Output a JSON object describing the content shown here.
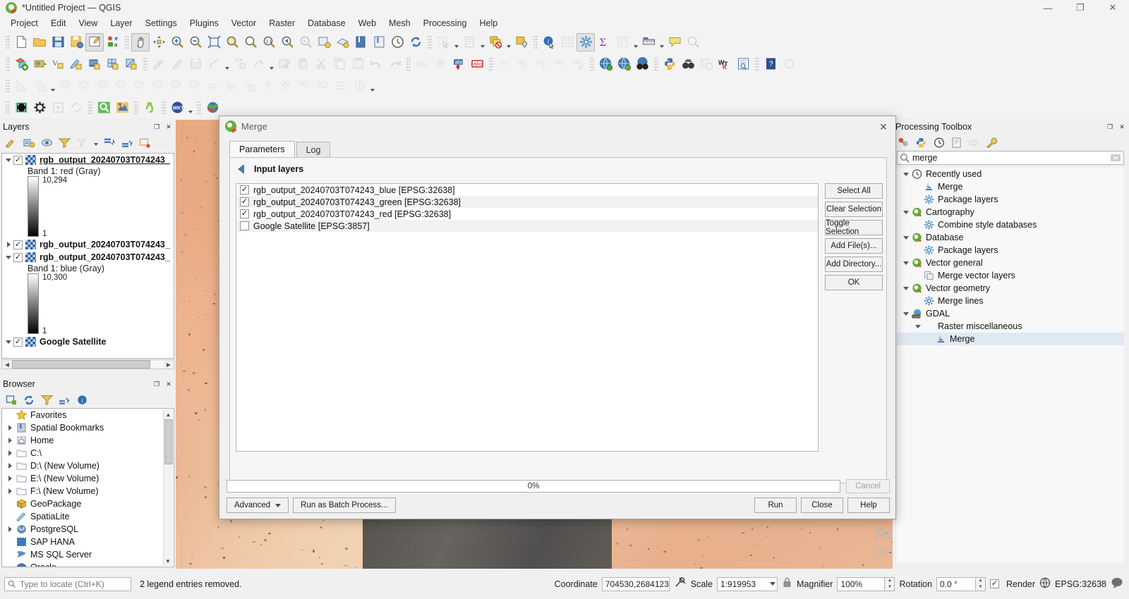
{
  "window": {
    "title": "*Untitled Project — QGIS",
    "app_icon": "qgis-logo-icon",
    "minimize": "—",
    "maximize": "❐",
    "close": "✕"
  },
  "menubar": {
    "items": [
      "Project",
      "Edit",
      "View",
      "Layer",
      "Settings",
      "Plugins",
      "Vector",
      "Raster",
      "Database",
      "Web",
      "Mesh",
      "Processing",
      "Help"
    ]
  },
  "toolbars": {
    "row1": [
      "new-project-icon",
      "open-project-icon",
      "save-project-icon",
      "save-project-as-icon",
      "new-print-layout-icon",
      "style-manager-icon",
      "pan-map-icon",
      "pan-to-selection-icon",
      "zoom-in-icon",
      "zoom-out-icon",
      "zoom-full-icon",
      "zoom-to-selection-icon",
      "zoom-to-layer-icon",
      "zoom-native-icon",
      "zoom-last-icon",
      "zoom-next-icon",
      "refresh-icon",
      "new-map-view-icon",
      "new-3d-map-view-icon",
      "show-bookmarks-icon",
      "temporal-controller-icon",
      "refresh-map-icon",
      "select-features-icon",
      "select-value-icon",
      "deselect-features-icon",
      "select-location-icon",
      "identify-features-icon",
      "open-attribute-table-icon",
      "processing-toolbox-icon",
      "statistical-summary-icon",
      "show-form-icon",
      "measure-line-icon",
      "map-tips-icon",
      "search-qms-icon"
    ],
    "row2": [
      "add-vector-layer-icon",
      "add-raster-layer-icon",
      "add-mesh-layer-icon",
      "add-delimited-text-layer-icon",
      "add-postgis-layer-icon",
      "add-spatialite-layer-icon",
      "add-wms-layer-icon",
      "current-edits-icon",
      "toggle-editing-icon",
      "save-layer-edits-icon",
      "add-line-feature-icon",
      "add-point-feature-icon",
      "vertex-tool-icon",
      "modify-attributes-icon",
      "delete-selected-icon",
      "cut-features-icon",
      "copy-features-icon",
      "paste-features-icon",
      "undo-icon",
      "redo-icon",
      "label-abc-icon",
      "label-toggle-icon",
      "pin-labels-icon",
      "highlight-labels-icon",
      "move-label-icon",
      "rotate-label-icon",
      "show-hide-labels-icon",
      "change-label-icon",
      "change-label-properties-icon",
      "metasearch-icon",
      "qgis-cloud-icon",
      "georeferencer-icon",
      "python-console-icon",
      "osm-place-search-icon",
      "raster-calculator-icon",
      "wkt-icon",
      "layout-manager-icon",
      "help-icon",
      "plugin-icon"
    ],
    "row3": [
      "measure-icon",
      "add-point-icon",
      "select-icon",
      "snapping-icon",
      "rotate-icon",
      "simplify-icon",
      "add-ring-icon",
      "add-part-icon",
      "fill-ring-icon",
      "delete-ring-icon",
      "delete-part-icon",
      "reshape-features-icon",
      "offset-curve-icon",
      "split-features-icon",
      "split-parts-icon",
      "merge-features-icon",
      "merge-attributes-icon",
      "rotate-point-symbols-icon",
      "offset-point-symbol-icon"
    ],
    "row4": [
      "contrast-icon",
      "options-icon",
      "add-tab-icon",
      "reload-icon",
      "qms-search-icon",
      "qms-icon",
      "lizmap-icon",
      "wkt-dropdown-icon",
      "earth-icon"
    ]
  },
  "layers_panel": {
    "title": "Layers",
    "tools": [
      "open-layer-styling-icon",
      "add-group-icon",
      "manage-map-themes-icon",
      "filter-legend-icon",
      "filter-legend-expression-icon",
      "expand-all-icon",
      "collapse-all-icon",
      "remove-layer-icon"
    ],
    "items": [
      {
        "name": "rgb_output_20240703T074243_",
        "checked": true,
        "expanded": true,
        "selected": true,
        "band_label": "Band 1: red (Gray)",
        "ramp_max": "10,294",
        "ramp_min": "1"
      },
      {
        "name": "rgb_output_20240703T074243_",
        "checked": true,
        "expanded": false,
        "selected": false,
        "band_label": null,
        "ramp_max": null,
        "ramp_min": null
      },
      {
        "name": "rgb_output_20240703T074243_",
        "checked": true,
        "expanded": true,
        "selected": false,
        "band_label": "Band 1: blue (Gray)",
        "ramp_max": "10,300",
        "ramp_min": "1"
      },
      {
        "name": "Google Satellite",
        "checked": true,
        "expanded": true,
        "selected": false,
        "band_label": null,
        "ramp_max": null,
        "ramp_min": null
      }
    ]
  },
  "browser_panel": {
    "title": "Browser",
    "tools": [
      "add-layer-icon",
      "refresh-icon",
      "filter-browser-icon",
      "collapse-all-icon",
      "properties-icon"
    ],
    "items": [
      {
        "label": "Favorites",
        "icon": "star-icon",
        "expandable": false
      },
      {
        "label": "Spatial Bookmarks",
        "icon": "bookmark-icon",
        "expandable": true
      },
      {
        "label": "Home",
        "icon": "home-icon",
        "expandable": true
      },
      {
        "label": "C:\\",
        "icon": "folder-icon",
        "expandable": true
      },
      {
        "label": "D:\\ (New Volume)",
        "icon": "folder-icon",
        "expandable": true
      },
      {
        "label": "E:\\ (New Volume)",
        "icon": "folder-icon",
        "expandable": true
      },
      {
        "label": "F:\\ (New Volume)",
        "icon": "folder-icon",
        "expandable": true
      },
      {
        "label": "GeoPackage",
        "icon": "geopackage-icon",
        "expandable": false
      },
      {
        "label": "SpatiaLite",
        "icon": "spatialite-icon",
        "expandable": false
      },
      {
        "label": "PostgreSQL",
        "icon": "postgresql-icon",
        "expandable": true
      },
      {
        "label": "SAP HANA",
        "icon": "sap-hana-icon",
        "expandable": false
      },
      {
        "label": "MS SQL Server",
        "icon": "mssql-icon",
        "expandable": false
      },
      {
        "label": "Oracle",
        "icon": "oracle-icon",
        "expandable": false
      }
    ]
  },
  "processing_toolbox": {
    "title": "Processing Toolbox",
    "tools": [
      "models-icon",
      "scripts-icon",
      "history-icon",
      "results-viewer-icon",
      "edit-rendering-styles-icon",
      "options-icon"
    ],
    "search": {
      "value": "merge",
      "clear_icon": "clear-search-icon",
      "search_icon": "search-icon"
    },
    "tree": [
      {
        "label": "Recently used",
        "icon": "clock-icon",
        "depth": 0,
        "expanded": true,
        "selected": false
      },
      {
        "label": "Merge",
        "icon": "gdal-merge-icon",
        "depth": 1,
        "expanded": null,
        "selected": false
      },
      {
        "label": "Package layers",
        "icon": "gear-blue-icon",
        "depth": 1,
        "expanded": null,
        "selected": false
      },
      {
        "label": "Cartography",
        "icon": "qgis-icon",
        "depth": 0,
        "expanded": true,
        "selected": false
      },
      {
        "label": "Combine style databases",
        "icon": "gear-blue-icon",
        "depth": 1,
        "expanded": null,
        "selected": false
      },
      {
        "label": "Database",
        "icon": "qgis-icon",
        "depth": 0,
        "expanded": true,
        "selected": false
      },
      {
        "label": "Package layers",
        "icon": "gear-blue-icon",
        "depth": 1,
        "expanded": null,
        "selected": false
      },
      {
        "label": "Vector general",
        "icon": "qgis-icon",
        "depth": 0,
        "expanded": true,
        "selected": false
      },
      {
        "label": "Merge vector layers",
        "icon": "merge-vector-icon",
        "depth": 1,
        "expanded": null,
        "selected": false
      },
      {
        "label": "Vector geometry",
        "icon": "qgis-icon",
        "depth": 0,
        "expanded": true,
        "selected": false
      },
      {
        "label": "Merge lines",
        "icon": "gear-blue-icon",
        "depth": 1,
        "expanded": null,
        "selected": false
      },
      {
        "label": "GDAL",
        "icon": "gdal-icon",
        "depth": 0,
        "expanded": true,
        "selected": false
      },
      {
        "label": "Raster miscellaneous",
        "icon": "",
        "depth": 1,
        "expanded": true,
        "selected": false
      },
      {
        "label": "Merge",
        "icon": "gdal-merge-icon",
        "depth": 2,
        "expanded": null,
        "selected": true
      }
    ]
  },
  "merge_dialog": {
    "title": "Merge",
    "close_icon": "close-icon",
    "tabs": [
      {
        "label": "Parameters",
        "active": true
      },
      {
        "label": "Log",
        "active": false
      }
    ],
    "section": {
      "collapse_icon": "collapse-left-icon",
      "label": "Input layers"
    },
    "layers": [
      {
        "label": "rgb_output_20240703T074243_blue [EPSG:32638]",
        "checked": true
      },
      {
        "label": "rgb_output_20240703T074243_green [EPSG:32638]",
        "checked": true
      },
      {
        "label": "rgb_output_20240703T074243_red [EPSG:32638]",
        "checked": true
      },
      {
        "label": "Google Satellite [EPSG:3857]",
        "checked": false
      }
    ],
    "side_buttons": [
      "Select All",
      "Clear Selection",
      "Toggle Selection",
      "Add File(s)...",
      "Add Directory...",
      "OK"
    ],
    "progress": {
      "value": "0%",
      "percent": 0
    },
    "cancel_label": "Cancel",
    "footer": {
      "advanced": "Advanced",
      "batch": "Run as Batch Process...",
      "run": "Run",
      "close": "Close",
      "help": "Help"
    }
  },
  "statusbar": {
    "locate_placeholder": "Type to locate (Ctrl+K)",
    "locate_icon": "search-icon",
    "message": "2 legend entries removed.",
    "coordinate_label": "Coordinate",
    "coordinate_value": "704530,2684123",
    "extent_icon": "toggle-extents-icon",
    "scale_label": "Scale",
    "scale_value": "1:919953",
    "lock_icon": "lock-scale-icon",
    "magnifier_label": "Magnifier",
    "magnifier_value": "100%",
    "rotation_label": "Rotation",
    "rotation_value": "0.0 °",
    "render_label": "Render",
    "render_checked": true,
    "crs_label": "EPSG:32638",
    "crs_icon": "globe-icon",
    "messages_icon": "message-bubble-icon"
  },
  "watermark": {
    "line1": "Activate Windows",
    "line2": "Go to Settings to activate Windows."
  }
}
